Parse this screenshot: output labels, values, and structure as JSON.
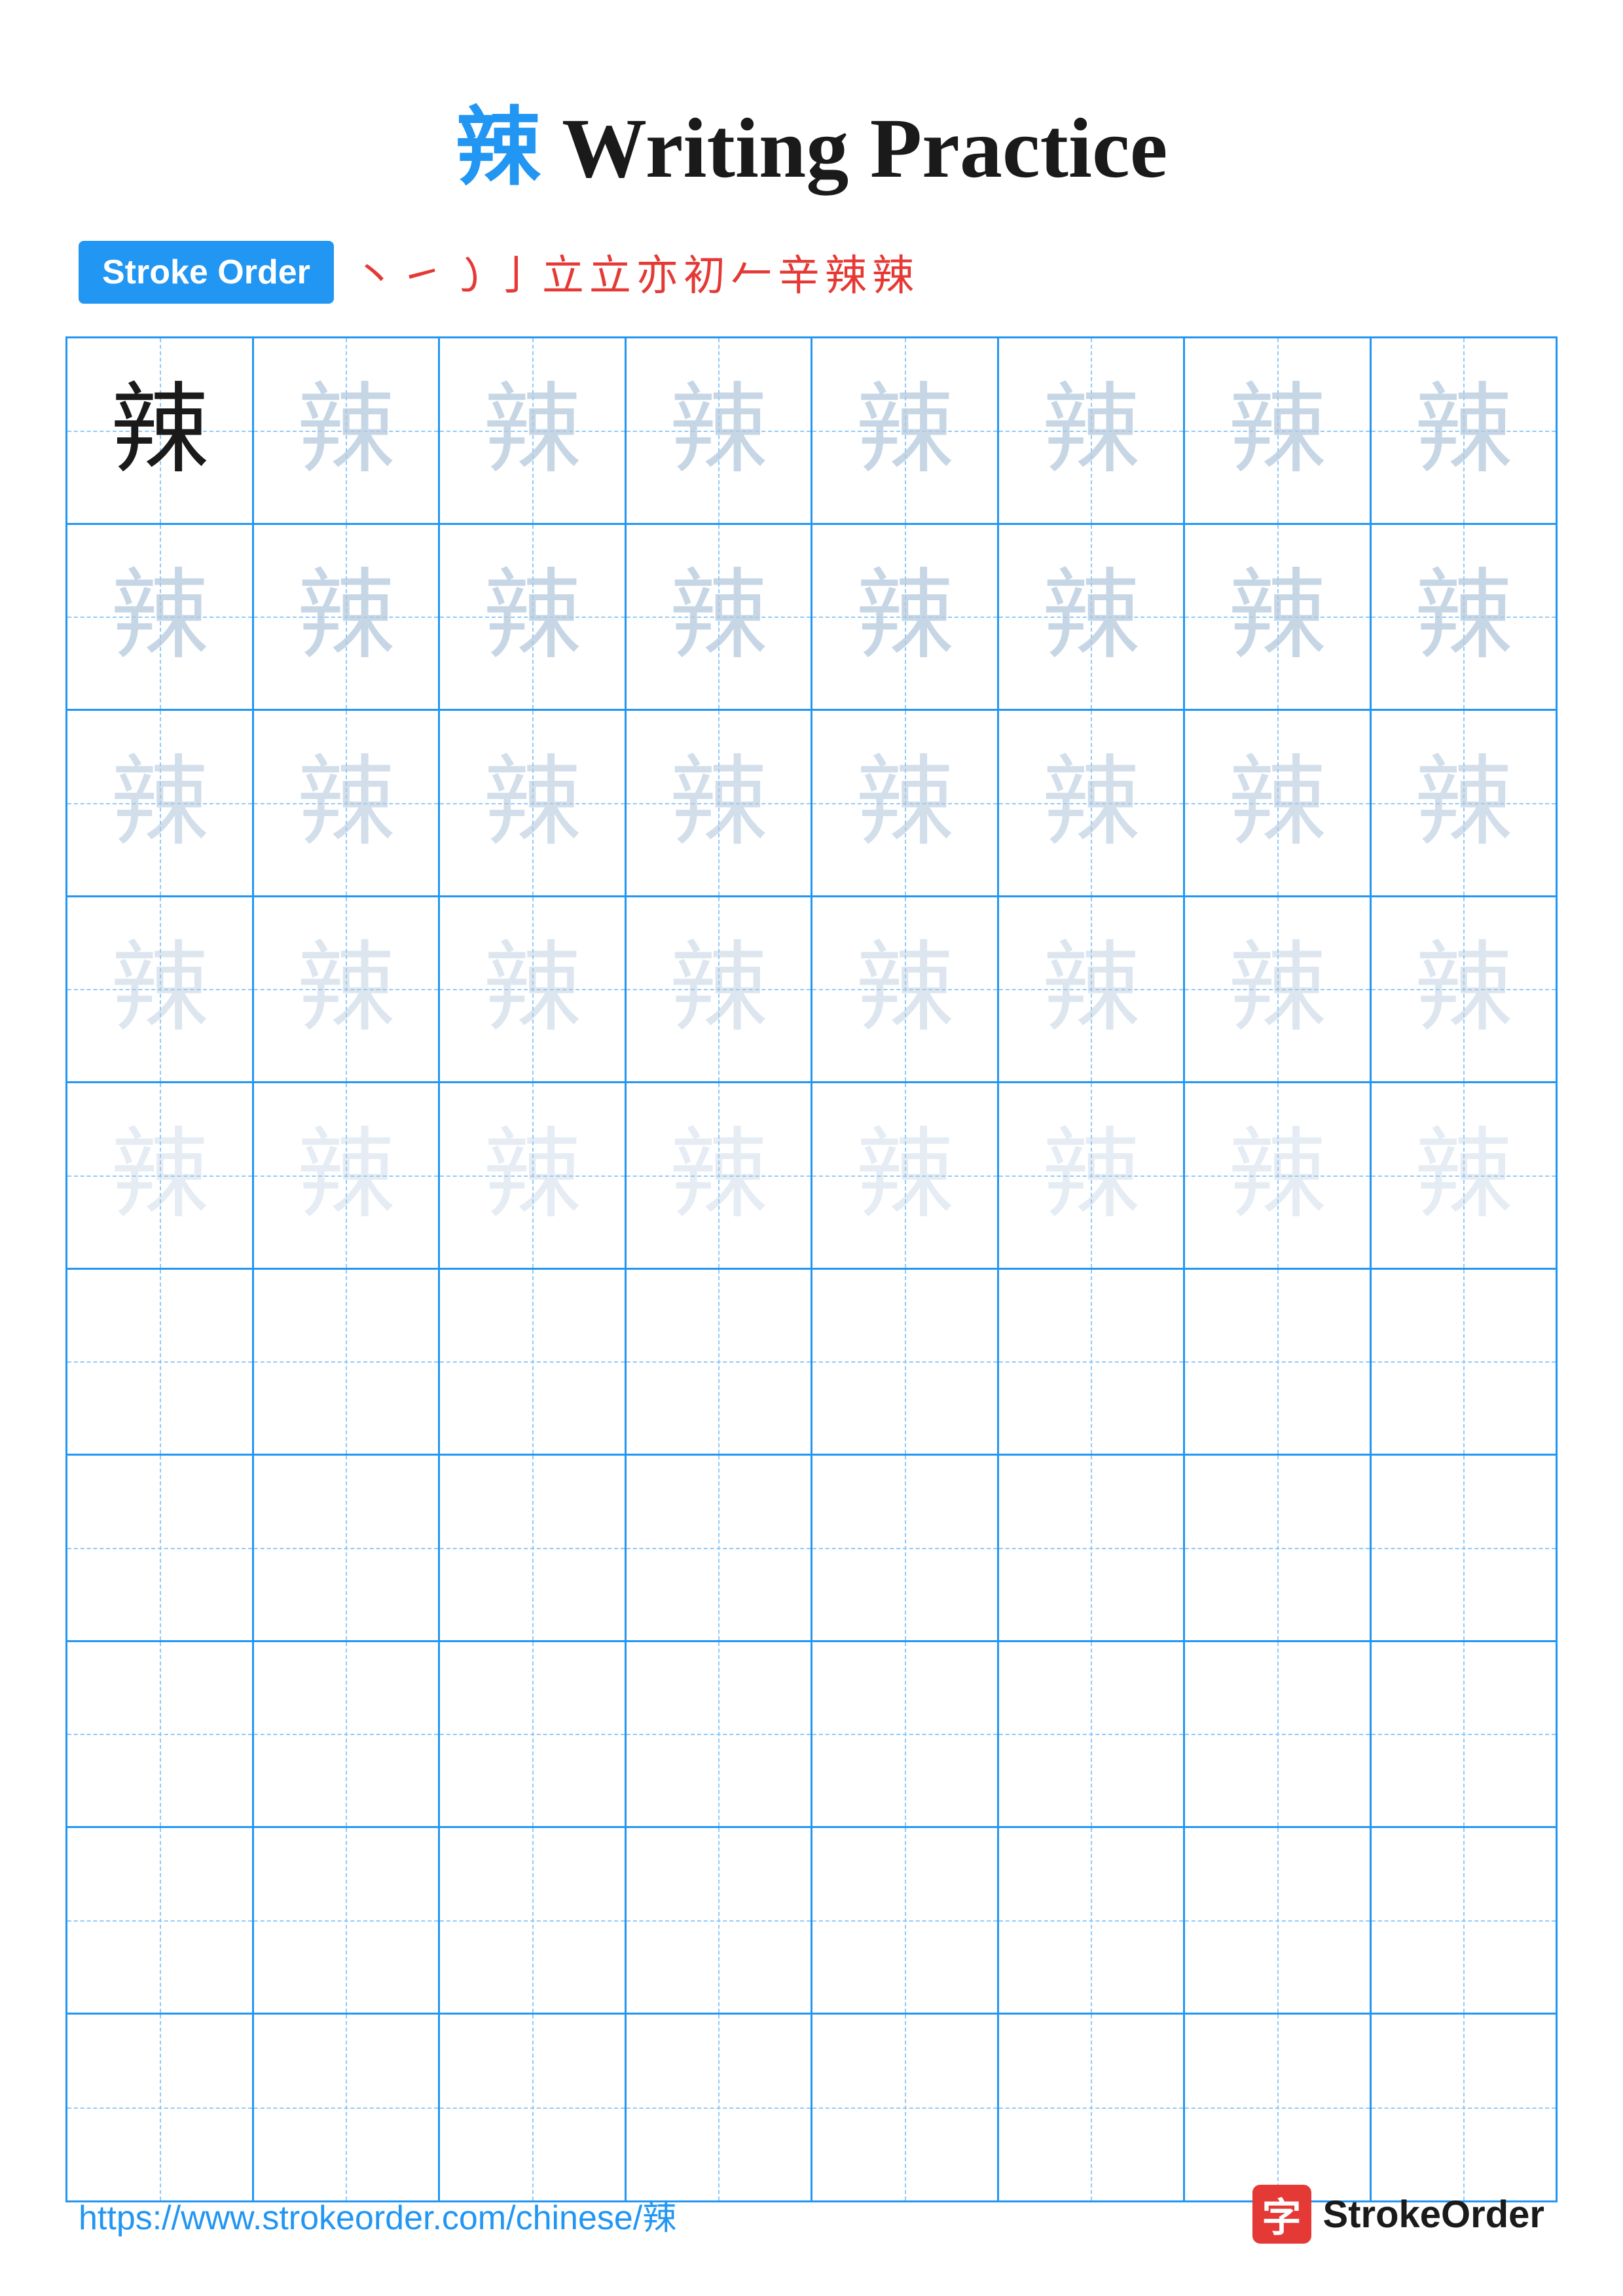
{
  "title": {
    "char": "辣",
    "text": " Writing Practice"
  },
  "stroke_order": {
    "badge_label": "Stroke Order",
    "strokes": [
      "丶",
      "㇀",
      "㇁",
      "亅",
      "立",
      "立",
      "亦",
      "𠂉",
      "𠂉",
      "辣",
      "辣",
      "辣"
    ]
  },
  "grid": {
    "rows": 10,
    "cols": 8,
    "char": "辣"
  },
  "footer": {
    "url": "https://www.strokeorder.com/chinese/辣",
    "brand_icon": "字",
    "brand_name": "StrokeOrder"
  }
}
